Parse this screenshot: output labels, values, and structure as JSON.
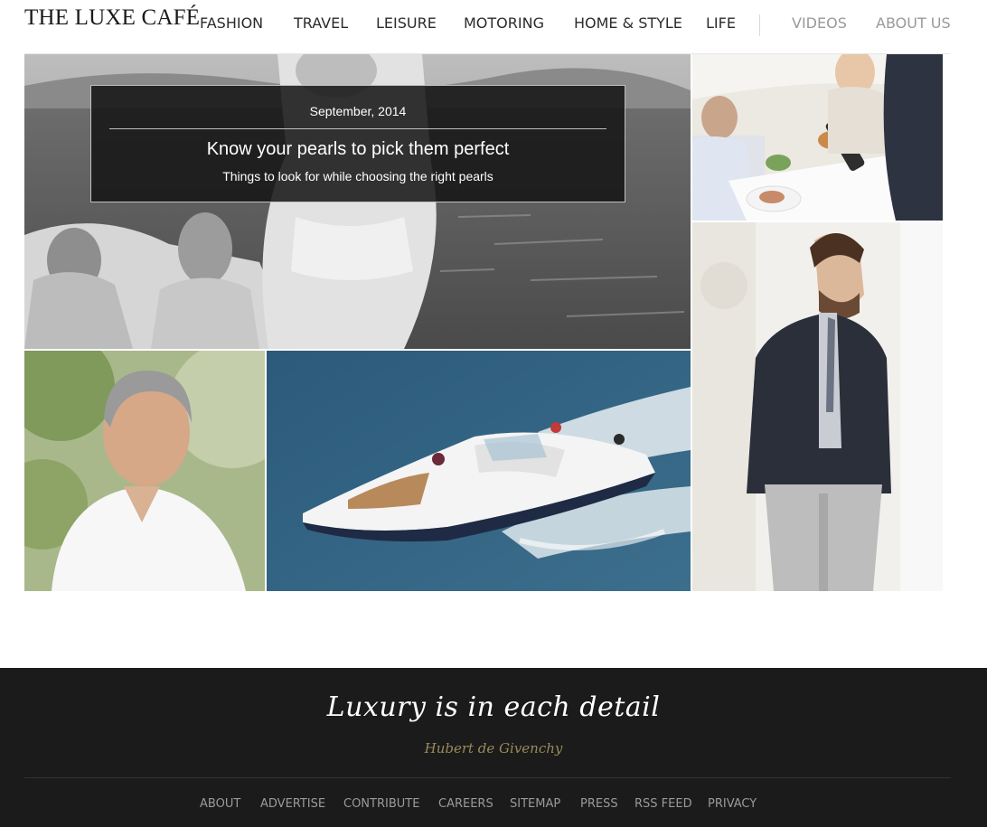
{
  "header": {
    "logo": "THE LUXE CAFÉ",
    "nav": [
      {
        "label": "FASHION"
      },
      {
        "label": "TRAVEL"
      },
      {
        "label": "LEISURE"
      },
      {
        "label": "MOTORING"
      },
      {
        "label": "HOME & STYLE"
      },
      {
        "label": "LIFE"
      },
      {
        "label": "VIDEOS"
      },
      {
        "label": "ABOUT US"
      }
    ]
  },
  "feature": {
    "date": "September, 2014",
    "title": "Know your pearls to pick them perfect",
    "subtitle": "Things to look for while choosing the right pearls"
  },
  "footer": {
    "quote": "Luxury is in each detail",
    "author": "Hubert de Givenchy",
    "links": [
      {
        "label": "ABOUT"
      },
      {
        "label": "ADVERTISE"
      },
      {
        "label": "CONTRIBUTE"
      },
      {
        "label": "CAREERS"
      },
      {
        "label": "SITEMAP"
      },
      {
        "label": "PRESS"
      },
      {
        "label": "RSS FEED"
      },
      {
        "label": "PRIVACY"
      }
    ]
  },
  "colors": {
    "text": "#2b2b2b",
    "muted_nav": "#999999",
    "footer_bg": "#1b1b1b",
    "author_gold": "#9a8a5a"
  }
}
